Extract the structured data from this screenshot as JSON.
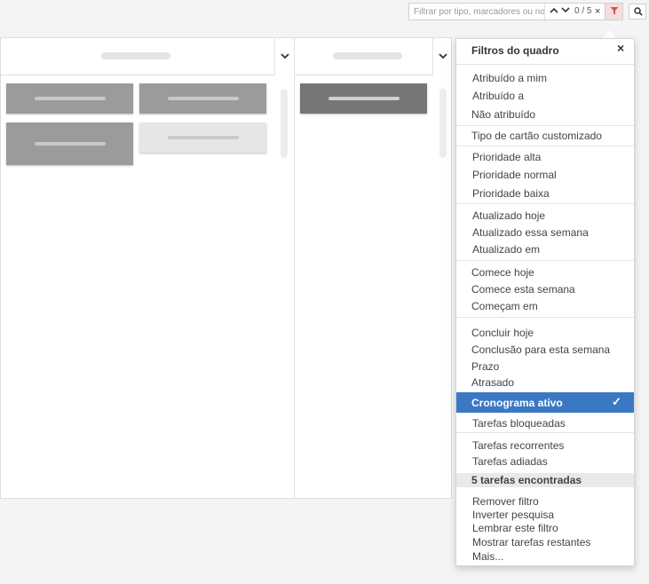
{
  "filter_bar": {
    "search_placeholder": "Filtrar por tipo, marcadores ou no",
    "result_counter": "0 / 5",
    "clear_symbol": "×",
    "nav_up_icon": "chevron-up-icon",
    "nav_down_icon": "chevron-down-icon",
    "filter_icon": "funnel-icon",
    "search_icon": "search-icon",
    "filter_active_color": "#d9534f"
  },
  "board_filters": {
    "title": "Filtros do quadro",
    "close_symbol": "×",
    "groups": {
      "assignment": [
        "Atribuído a mim",
        "Atribuído a",
        "Não atribuído"
      ],
      "card_type": [
        "Tipo de cartão customizado"
      ],
      "priority": [
        "Prioridade alta",
        "Prioridade normal",
        "Prioridade baixa"
      ],
      "updated": [
        "Atualizado hoje",
        "Atualizado essa semana",
        "Atualizado em"
      ],
      "start": [
        "Comece hoje",
        "Comece esta semana",
        "Começam em"
      ],
      "due": [
        "Concluir hoje",
        "Conclusão para esta semana",
        "Prazo",
        "Atrasado"
      ],
      "schedule": [
        "Cronograma ativo",
        "Tarefas bloqueadas"
      ],
      "recurring": [
        "Tarefas recorrentes",
        "Tarefas adiadas"
      ]
    },
    "selected_item": "Cronograma ativo",
    "selected_color": "#3b78c4",
    "check_symbol": "✓",
    "result_count": "5 tarefas encontradas",
    "actions": [
      "Remover filtro",
      "Inverter pesquisa",
      "Lembrar este filtro",
      "Mostrar tarefas restantes",
      "Mais..."
    ]
  }
}
